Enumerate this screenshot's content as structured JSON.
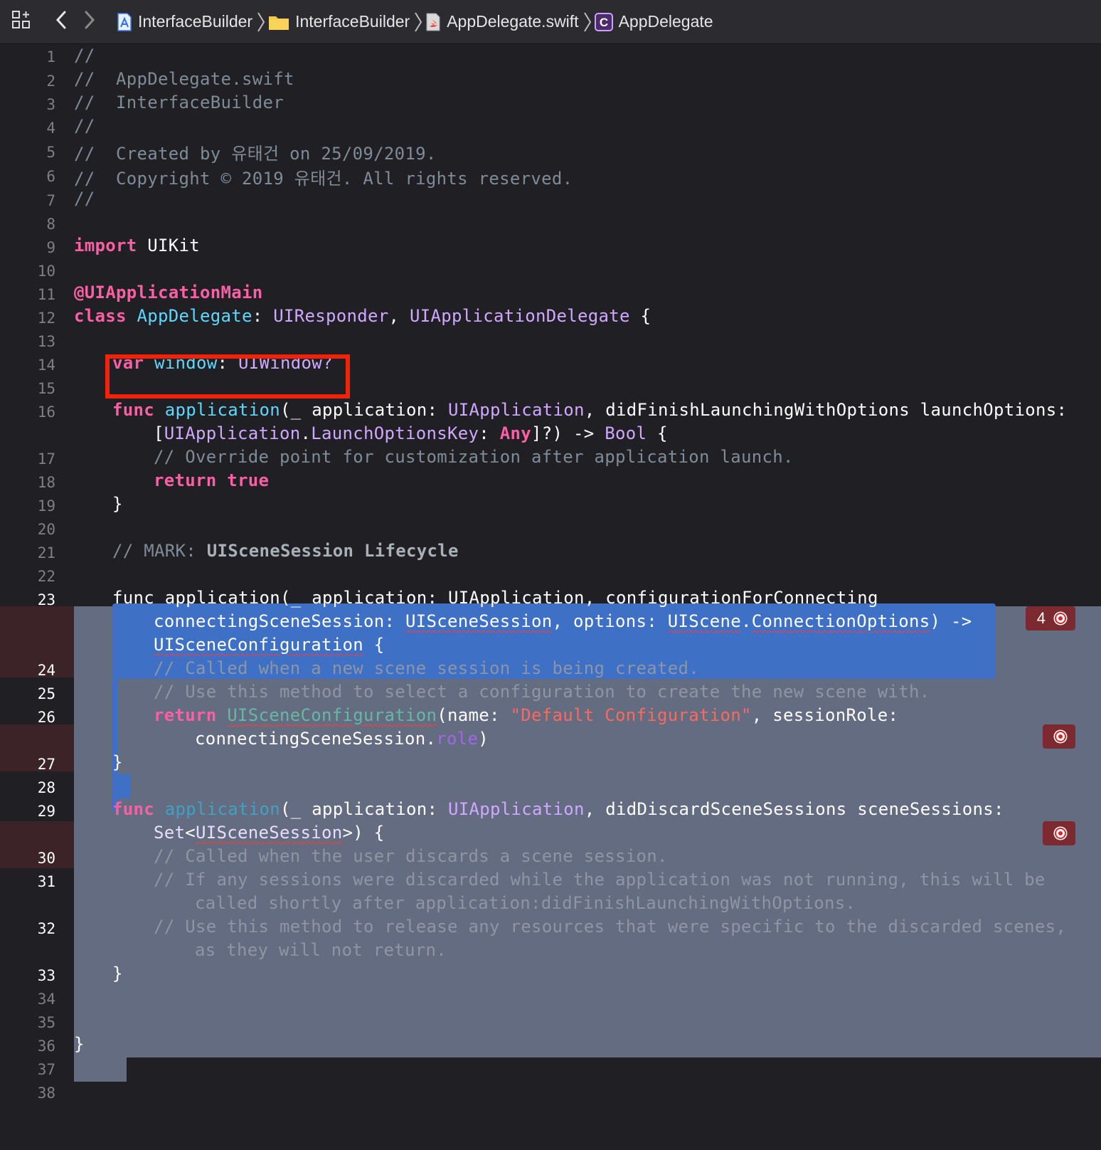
{
  "toolbar": {
    "breadcrumbs": [
      {
        "label": "InterfaceBuilder",
        "icon": "xcode-project-icon"
      },
      {
        "label": "InterfaceBuilder",
        "icon": "folder-icon"
      },
      {
        "label": "AppDelegate.swift",
        "icon": "swift-file-icon"
      },
      {
        "label": "AppDelegate",
        "icon": "class-c-icon"
      }
    ]
  },
  "editor": {
    "line_numbers": [
      "1",
      "2",
      "3",
      "4",
      "5",
      "6",
      "7",
      "8",
      "9",
      "10",
      "11",
      "12",
      "13",
      "14",
      "15",
      "16",
      "17",
      "18",
      "19",
      "20",
      "21",
      "22",
      "23",
      "24",
      "25",
      "26",
      "27",
      "28",
      "29",
      "30",
      "31",
      "32",
      "33",
      "34",
      "35",
      "36",
      "37",
      "38"
    ],
    "code": {
      "comment_slashes": "//",
      "file_name": "AppDelegate.swift",
      "project_name": "InterfaceBuilder",
      "created_line": "Created by 유태건 on 25/09/2019.",
      "copyright_line": "Copyright © 2019 유태건. All rights reserved.",
      "import_kw": "import",
      "import_module": "UIKit",
      "attr_main": "@UIApplicationMain",
      "class_kw": "class",
      "class_name": "AppDelegate",
      "superclass": "UIResponder",
      "protocol": "UIApplicationDelegate",
      "var_kw": "var",
      "var_name": "window",
      "var_type": "UIWindow?",
      "func_kw": "func",
      "func_name": "application",
      "underscore": "_",
      "param_application": "application",
      "type_uiapplication": "UIApplication",
      "label_did_finish": "didFinishLaunchingWithOptions",
      "param_launch_options": "launchOptions",
      "type_uiapplication_nested": "UIApplication",
      "type_launch_options_key": "LaunchOptionsKey",
      "type_any": "Any",
      "type_bool": "Bool",
      "comment_override": "// Override point for customization after application launch.",
      "return_kw": "return",
      "true_kw": "true",
      "mark_prefix": "// MARK:",
      "mark_title": "UISceneSession Lifecycle",
      "label_config_for_connecting": "configurationForConnecting",
      "param_connecting_scene_session": "connectingSceneSession",
      "type_uiscenesession": "UISceneSession",
      "label_options": "options",
      "type_uiscene": "UIScene",
      "type_connection_options": "ConnectionOptions",
      "type_uisceneconfiguration": "UISceneConfiguration",
      "comment_called_new_scene": "// Called when a new scene session is being created.",
      "comment_use_select": "// Use this method to select a configuration to create the new scene with.",
      "init_uisceneconfiguration": "UISceneConfiguration",
      "arg_name": "name",
      "string_default_configuration": "\"Default Configuration\"",
      "arg_session_role": "sessionRole",
      "connecting_scene_session_ref": "connectingSceneSession",
      "prop_role": "role",
      "label_did_discard": "didDiscardSceneSessions",
      "param_scene_sessions": "sceneSessions",
      "type_set": "Set",
      "comment_called_discards": "// Called when the user discards a scene session.",
      "comment_if_any_1": "// If any sessions were discarded while the application was not running, this will be",
      "comment_if_any_2": "called shortly after application:didFinishLaunchingWithOptions.",
      "comment_use_release_1": "// Use this method to release any resources that were specific to the discarded scenes,",
      "comment_use_release_2": "as they will not return."
    }
  },
  "issues": {
    "line_23_count": "4"
  },
  "colors": {
    "keyword": "#fc5fa3",
    "declaration": "#5dd8ff",
    "type": "#d0a8ff",
    "comment": "#7f8c98",
    "string": "#fc6a5d",
    "selection_blue": "#3e70c6",
    "selection_grey": "#646c81",
    "error_band": "#5a2227",
    "highlight_box": "#f2230b"
  }
}
